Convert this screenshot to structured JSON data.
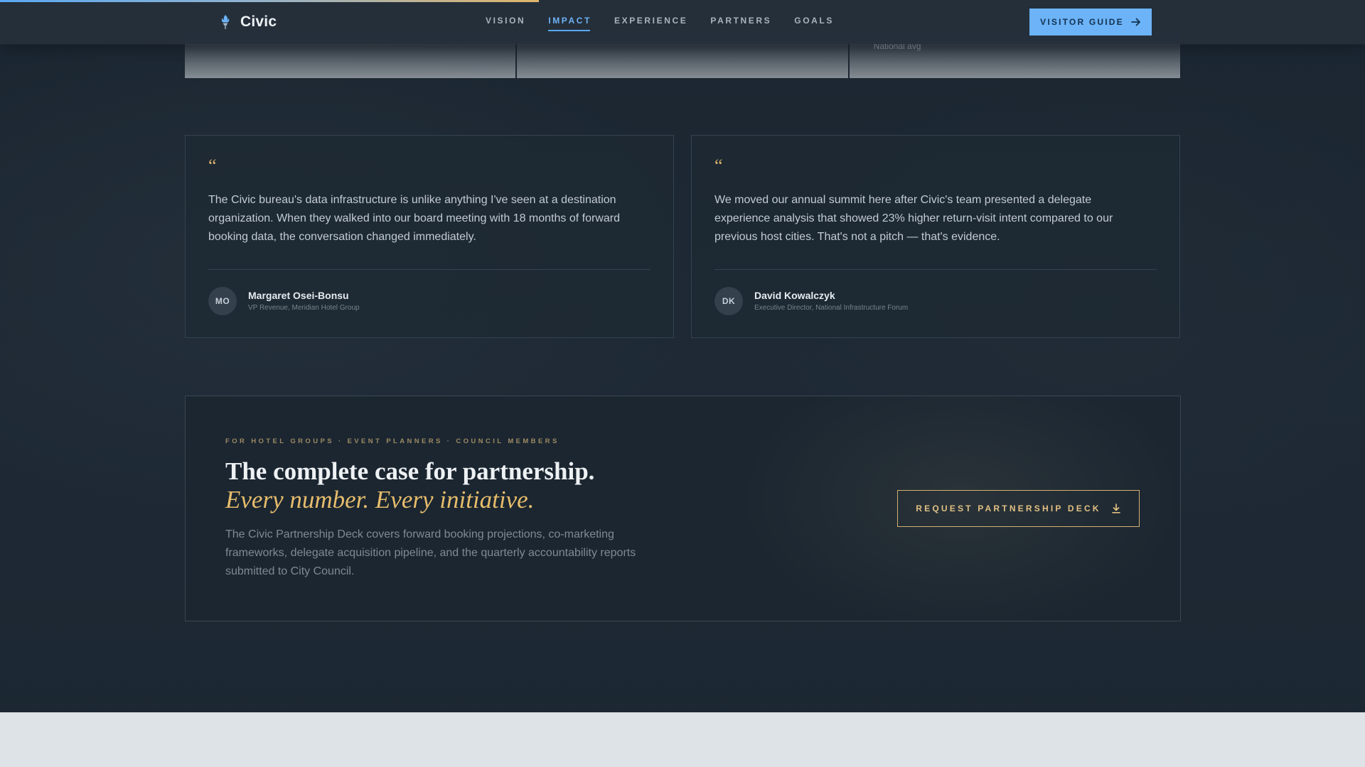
{
  "progress": {
    "fraction": 0.395
  },
  "header": {
    "brand_name": "Civic",
    "nav": [
      {
        "label": "VISION",
        "active": false
      },
      {
        "label": "IMPACT",
        "active": true
      },
      {
        "label": "EXPERIENCE",
        "active": false
      },
      {
        "label": "PARTNERS",
        "active": false
      },
      {
        "label": "GOALS",
        "active": false
      }
    ],
    "cta_label": "VISITOR GUIDE"
  },
  "stat_strip": {
    "cards": [
      {
        "caption": ""
      },
      {
        "caption": ""
      },
      {
        "caption": "National avg"
      }
    ]
  },
  "testimonials": [
    {
      "quote_mark": "“",
      "text": "The Civic bureau's data infrastructure is unlike anything I've seen at a destination organization. When they walked into our board meeting with 18 months of forward booking data, the conversation changed immediately.",
      "initials": "MO",
      "name": "Margaret Osei-Bonsu",
      "role": "VP Revenue, Meridian Hotel Group"
    },
    {
      "quote_mark": "“",
      "text": "We moved our annual summit here after Civic's team presented a delegate experience analysis that showed 23% higher return-visit intent compared to our previous host cities. That's not a pitch — that's evidence.",
      "initials": "DK",
      "name": "David Kowalczyk",
      "role": "Executive Director, National Infrastructure Forum"
    }
  ],
  "partnership": {
    "eyebrow": "FOR HOTEL GROUPS · EVENT PLANNERS · COUNCIL MEMBERS",
    "title": "The complete case for partnership.",
    "title_accent": "Every number. Every initiative.",
    "description": "The Civic Partnership Deck covers forward booking projections, co-marketing frameworks, delegate acquisition pipeline, and the quarterly accountability reports submitted to City Council.",
    "cta_label": "REQUEST PARTNERSHIP DECK"
  },
  "icons": {
    "brand": "torch-icon",
    "visitor_guide": "arrow-right-icon",
    "partnership_cta": "download-icon"
  },
  "colors": {
    "accent_blue": "#6cb3f8",
    "accent_gold": "#e8bd6c",
    "background": "#1c2732"
  }
}
